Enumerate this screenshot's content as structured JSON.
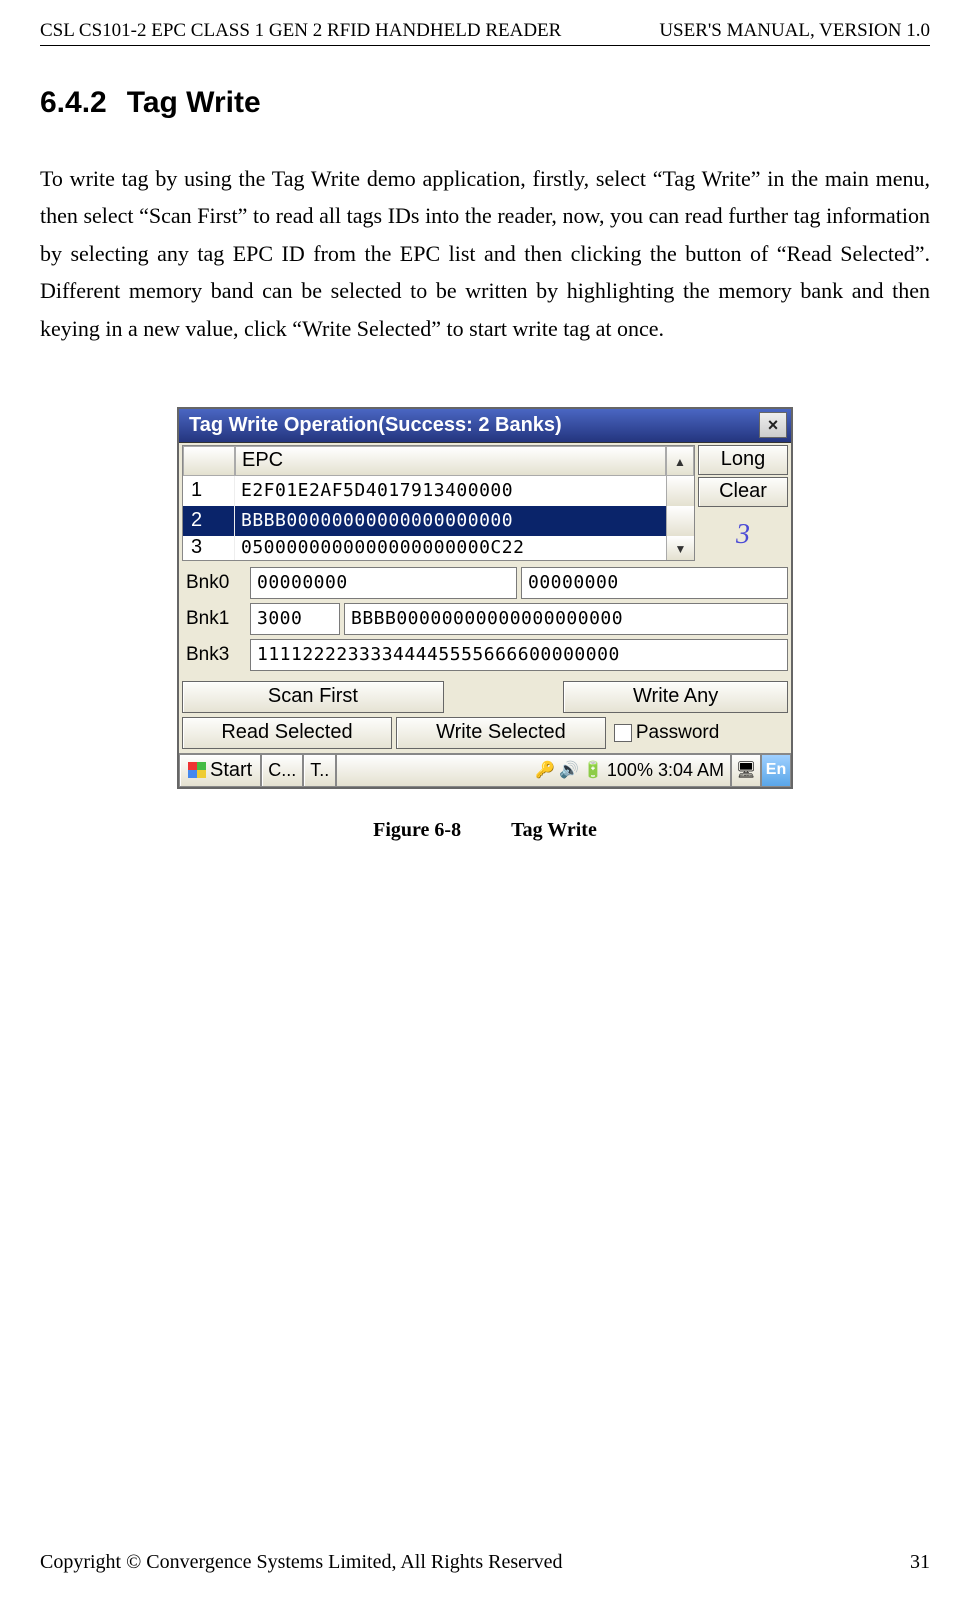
{
  "header": {
    "left": "CSL CS101-2 EPC CLASS 1 GEN 2 RFID HANDHELD READER",
    "right": "USER'S  MANUAL,  VERSION  1.0"
  },
  "section": {
    "number": "6.4.2",
    "title": "Tag Write"
  },
  "body_paragraph": "To write tag by using the Tag Write demo application, firstly, select “Tag Write” in the main menu, then select “Scan First” to read all tags IDs into the reader, now, you can read further tag information by selecting any tag EPC ID from the EPC list and then clicking the button of “Read Selected”. Different memory band can be selected to be written by highlighting the memory bank and then keying in a new value, click “Write Selected” to start write tag at once.",
  "window": {
    "title": "Tag Write Operation(Success:  2 Banks)",
    "close_icon": "×",
    "epc_header": "EPC",
    "long_button": "Long",
    "clear_button": "Clear",
    "count": "3",
    "rows": [
      {
        "n": "1",
        "epc": "E2F01E2AF5D4017913400000",
        "selected": false
      },
      {
        "n": "2",
        "epc": "BBBB00000000000000000000",
        "selected": true
      },
      {
        "n": "3",
        "epc": "0500000000000000000000C22",
        "selected": false
      }
    ],
    "banks": {
      "bnk0_label": "Bnk0",
      "bnk0_a": "00000000",
      "bnk0_b": "00000000",
      "bnk1_label": "Bnk1",
      "bnk1_a": "3000",
      "bnk1_b": "BBBB00000000000000000000",
      "bnk3_label": "Bnk3",
      "bnk3": "11112222333344445555666600000000"
    },
    "buttons": {
      "scan_first": "Scan First",
      "write_any": "Write Any",
      "read_selected": "Read Selected",
      "write_selected": "Write Selected",
      "password": "Password"
    },
    "taskbar": {
      "start": "Start",
      "app1": "C...",
      "app2": "T..",
      "battery_time": "100% 3:04 AM",
      "ime": "En"
    }
  },
  "figure": {
    "label": "Figure 6-8",
    "caption": "Tag Write"
  },
  "footer": {
    "copyright": "Copyright © Convergence Systems Limited, All Rights Reserved",
    "page": "31"
  }
}
